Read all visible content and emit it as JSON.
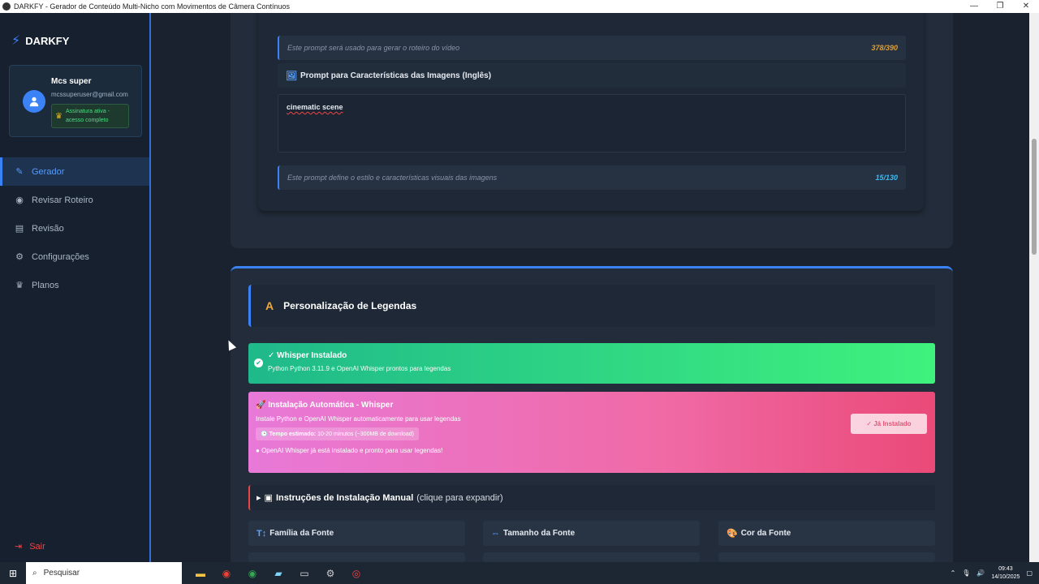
{
  "window": {
    "title": "DARKFY - Gerador de Conteúdo Multi-Nicho com Movimentos de Câmera Contínuos",
    "controls": [
      "—",
      "❐",
      "✕"
    ]
  },
  "sidebar": {
    "brand": "DARKFY",
    "user": {
      "name": "Mcs super",
      "email": "mcssuperuser@gmail.com",
      "subscription": "Assinatura ativa - acesso completo"
    },
    "items": [
      {
        "label": "Gerador",
        "icon": "pencil-icon",
        "active": true
      },
      {
        "label": "Revisar Roteiro",
        "icon": "eye-icon",
        "active": false
      },
      {
        "label": "Revisão",
        "icon": "clipboard-icon",
        "active": false
      },
      {
        "label": "Configurações",
        "icon": "gear-icon",
        "active": false
      },
      {
        "label": "Planos",
        "icon": "crown-icon",
        "active": false
      }
    ],
    "logout": "Sair"
  },
  "main": {
    "script_hint": "Este prompt será usado para gerar o roteiro do vídeo",
    "script_count": "378/390",
    "image_prompt_label": "Prompt para Características das Imagens (Inglês)",
    "image_prompt_value": "cinematic scene",
    "image_hint": "Este prompt define o estilo e características visuais das imagens",
    "image_count": "15/130",
    "subtitles_title": "Personalização de Legendas",
    "whisper_ok_title": "✓ Whisper Instalado",
    "whisper_ok_desc": "Python Python 3.11.9 e OpenAI Whisper prontos para legendas",
    "auto_title": "Instalação Automática - Whisper",
    "auto_desc": "Instale Python e OpenAI Whisper automaticamente para usar legendas",
    "auto_time_label": "Tempo estimado:",
    "auto_time_value": "10-20 minutos (~300MB de download)",
    "auto_status": "OpenAI Whisper já está instalado e pronto para usar legendas!",
    "installed_button": "✓ Já Instalado",
    "manual_title": "Instruções de Instalação Manual",
    "manual_hint": "(clique para expandir)",
    "font_family_label": "Família da Fonte",
    "font_size_label": "Tamanho da Fonte",
    "font_color_label": "Cor da Fonte"
  },
  "taskbar": {
    "search_placeholder": "Pesquisar",
    "time": "09:43",
    "date": "14/10/2025"
  },
  "colors": {
    "accent": "#3b82f6",
    "success_start": "#1fb98a",
    "success_end": "#3ff27d",
    "pink_start": "#e879d8",
    "pink_end": "#ea4a78",
    "script_count": "#e0a030",
    "image_count": "#38bdf8"
  }
}
